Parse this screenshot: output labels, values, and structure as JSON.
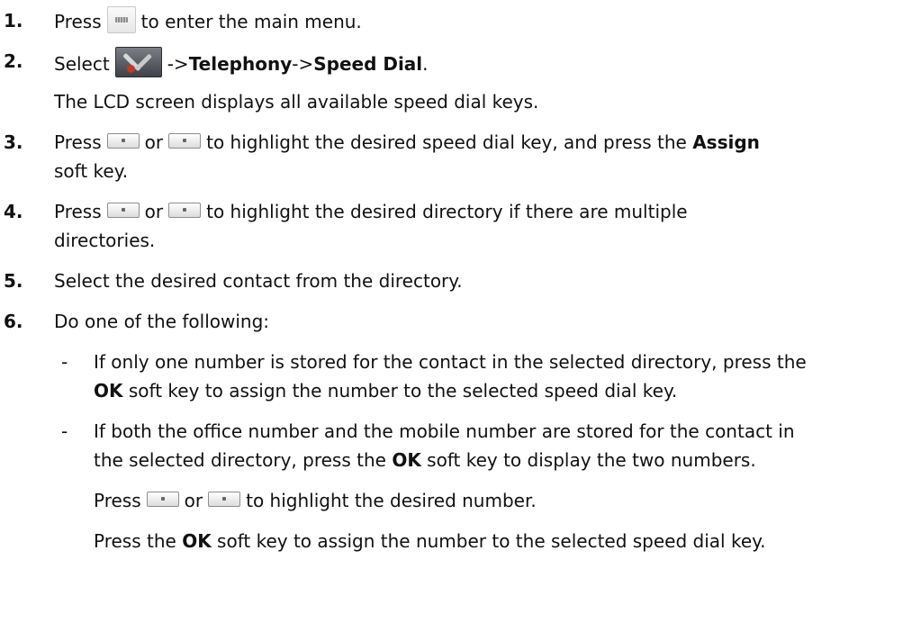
{
  "steps": [
    {
      "num": "1.",
      "pre": "Press",
      "post": "to enter the main menu."
    },
    {
      "num": "2.",
      "pre": "Select",
      "arrow1": "->",
      "bold1": "Telephony",
      "arrow2": "->",
      "bold2": "Speed Dial",
      "end": "."
    },
    {
      "line": "The LCD screen displays all available speed dial keys."
    },
    {
      "num": "3.",
      "pre": "Press",
      "or": "or",
      "mid": "to highlight the desired speed dial key, and press the",
      "bold": "Assign",
      "line2": "soft key."
    },
    {
      "num": "4.",
      "pre": "Press",
      "or": "or",
      "mid": "to highlight the desired directory if there are multiple",
      "line2": "directories."
    },
    {
      "num": "5.",
      "text": "Select the desired contact from the directory."
    },
    {
      "num": "6.",
      "text": "Do one of the following:"
    }
  ],
  "bullets": [
    {
      "dash": "-",
      "line1": "If only one number is stored for the contact in the selected directory, press the",
      "bold": "OK",
      "line2": "soft key to assign the number to the selected speed dial key."
    },
    {
      "dash": "-",
      "line1": "If both the office number and the mobile number are stored for the contact in",
      "pre2": "the selected directory, press the",
      "bold": "OK",
      "post2": "soft key to display the two numbers.",
      "press": "Press",
      "or": "or",
      "highlight": "to highlight the desired number.",
      "final_pre": "Press the",
      "final_bold": "OK",
      "final_post": "soft key to assign the number to the selected speed dial key."
    }
  ],
  "icons": {
    "menu_key": "menu-key-icon",
    "settings": "settings-tools-icon",
    "nav_up": "navigation-up-key-icon",
    "nav_down": "navigation-down-key-icon"
  }
}
